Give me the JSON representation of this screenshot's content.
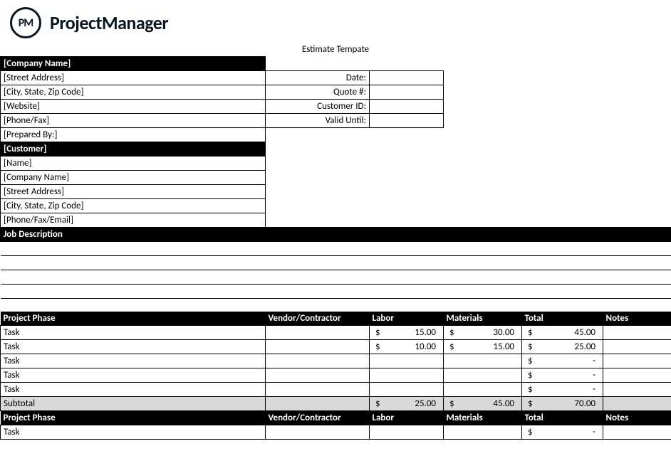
{
  "brand": {
    "badge": "PM",
    "name": "ProjectManager"
  },
  "title": "Estimate Tempate",
  "company_section": {
    "header": "[Company Name]",
    "fields": [
      "[Street Address]",
      "[City, State, Zip Code]",
      "[Website]",
      "[Phone/Fax]",
      "[Prepared By:]"
    ],
    "meta_labels": [
      "Date:",
      "Quote #:",
      "Customer ID:",
      "Valid Until:"
    ],
    "meta_values": [
      "",
      "",
      "",
      ""
    ]
  },
  "customer_section": {
    "header": "[Customer]",
    "fields": [
      "[Name]",
      "[Company Name]",
      "[Street Address]",
      "[City, State, Zip Code]",
      "[Phone/Fax/Email]"
    ]
  },
  "job_desc_header": "Job Description",
  "columns": {
    "phase": "Project Phase",
    "vendor": "Vendor/Contractor",
    "labor": "Labor",
    "materials": "Materials",
    "total": "Total",
    "notes": "Notes"
  },
  "rows": {
    "task_label": "Task",
    "subtotal_label": "Subtotal",
    "dash": "-"
  },
  "phase1": {
    "tasks": [
      {
        "labor": "15.00",
        "materials": "30.00",
        "total": "45.00"
      },
      {
        "labor": "10.00",
        "materials": "15.00",
        "total": "25.00"
      },
      {
        "labor": "",
        "materials": "",
        "total": "-"
      },
      {
        "labor": "",
        "materials": "",
        "total": "-"
      },
      {
        "labor": "",
        "materials": "",
        "total": "-"
      }
    ],
    "subtotal": {
      "labor": "25.00",
      "materials": "45.00",
      "total": "70.00"
    }
  },
  "phase2": {
    "tasks": [
      {
        "labor": "",
        "materials": "",
        "total": "-"
      }
    ]
  },
  "currency_symbol": "$"
}
